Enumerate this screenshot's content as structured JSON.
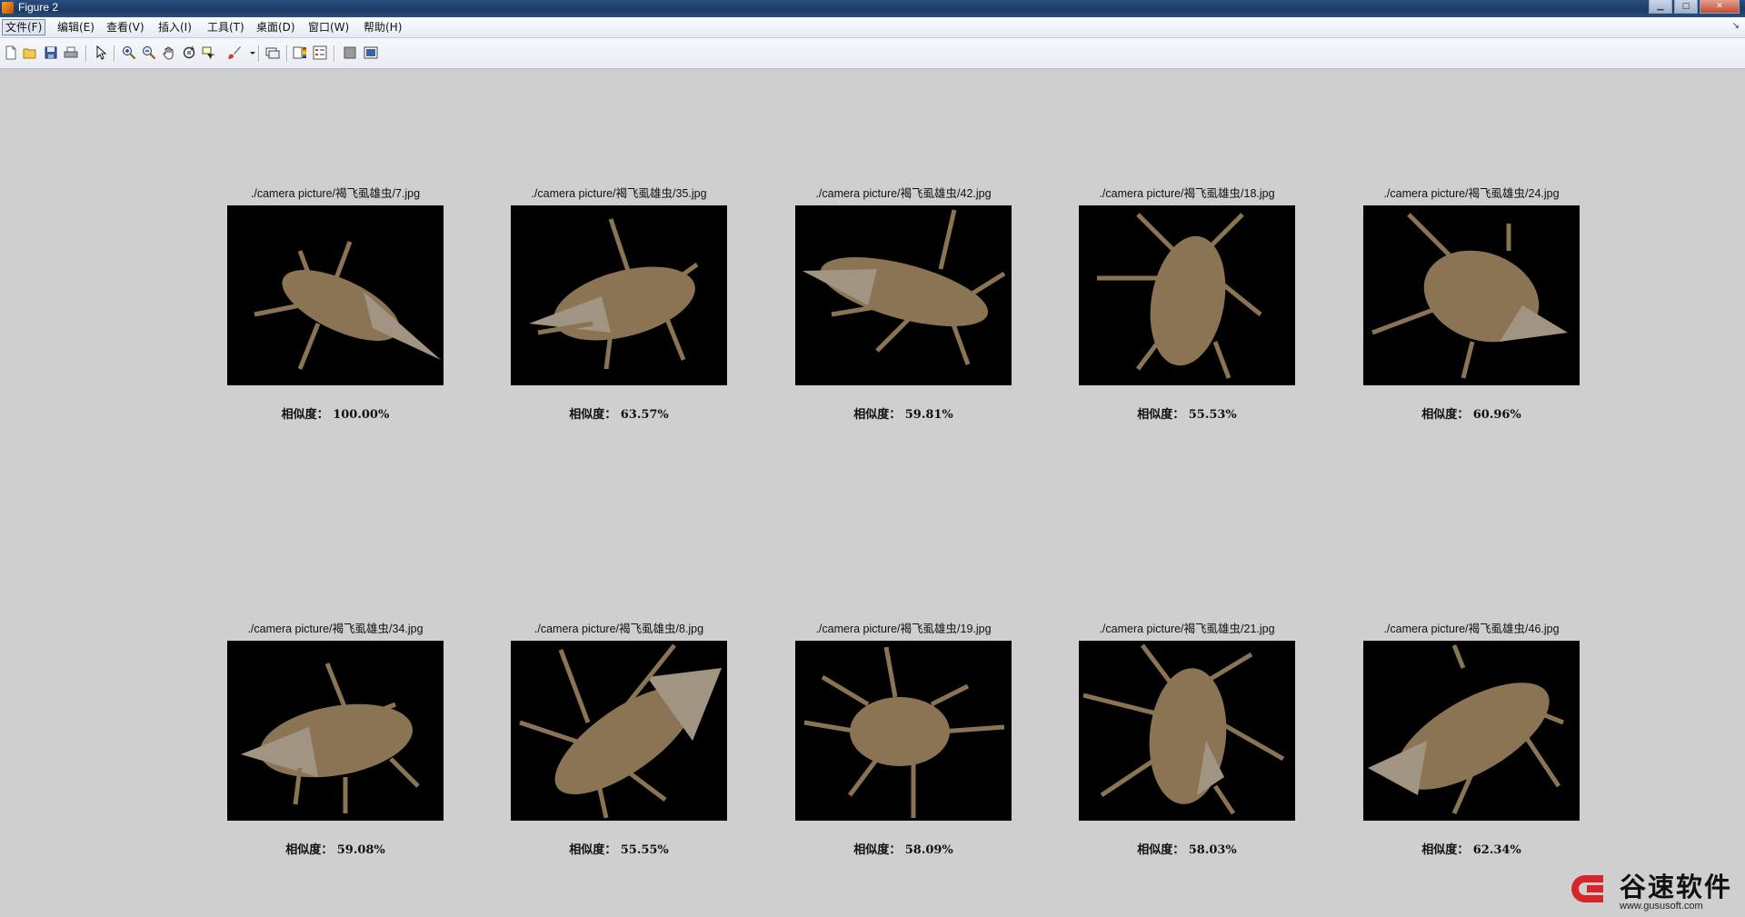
{
  "window": {
    "title": "Figure 2"
  },
  "menu": [
    {
      "label": "文件(F)",
      "active": true
    },
    {
      "label": "编辑(E)"
    },
    {
      "label": "查看(V)"
    },
    {
      "label": "插入(I)"
    },
    {
      "label": "工具(T)"
    },
    {
      "label": "桌面(D)"
    },
    {
      "label": "窗口(W)"
    },
    {
      "label": "帮助(H)"
    }
  ],
  "toolbar": [
    "new-figure-icon",
    "open-file-icon",
    "save-icon",
    "print-icon",
    "edit-plot-icon",
    "zoom-in-icon",
    "zoom-out-icon",
    "pan-icon",
    "rotate-3d-icon",
    "data-cursor-icon",
    "brush-icon",
    "link-plot-icon",
    "colorbar-icon",
    "legend-icon",
    "hide-plot-tools-icon",
    "show-plot-tools-icon"
  ],
  "panels": [
    {
      "caption": "./camera picture/褐飞虱雄虫/7.jpg",
      "similarity": "相似度： 100.00%"
    },
    {
      "caption": "./camera picture/褐飞虱雄虫/35.jpg",
      "similarity": "相似度： 63.57%"
    },
    {
      "caption": "./camera picture/褐飞虱雄虫/42.jpg",
      "similarity": "相似度： 59.81%"
    },
    {
      "caption": "./camera picture/褐飞虱雄虫/18.jpg",
      "similarity": "相似度： 55.53%"
    },
    {
      "caption": "./camera picture/褐飞虱雄虫/24.jpg",
      "similarity": "相似度： 60.96%"
    },
    {
      "caption": "./camera picture/褐飞虱雄虫/34.jpg",
      "similarity": "相似度： 59.08%"
    },
    {
      "caption": "./camera picture/褐飞虱雄虫/8.jpg",
      "similarity": "相似度： 55.55%"
    },
    {
      "caption": "./camera picture/褐飞虱雄虫/19.jpg",
      "similarity": "相似度： 58.09%"
    },
    {
      "caption": "./camera picture/褐飞虱雄虫/21.jpg",
      "similarity": "相似度： 58.03%"
    },
    {
      "caption": "./camera picture/褐飞虱雄虫/46.jpg",
      "similarity": "相似度： 62.34%"
    }
  ],
  "watermark": {
    "brand": "谷速软件",
    "url": "www.gususoft.com"
  },
  "colors": {
    "figure_bg": "#cfcfcf",
    "image_bg": "#000000",
    "insect": "#8a7454",
    "brand_red": "#d6262b"
  }
}
